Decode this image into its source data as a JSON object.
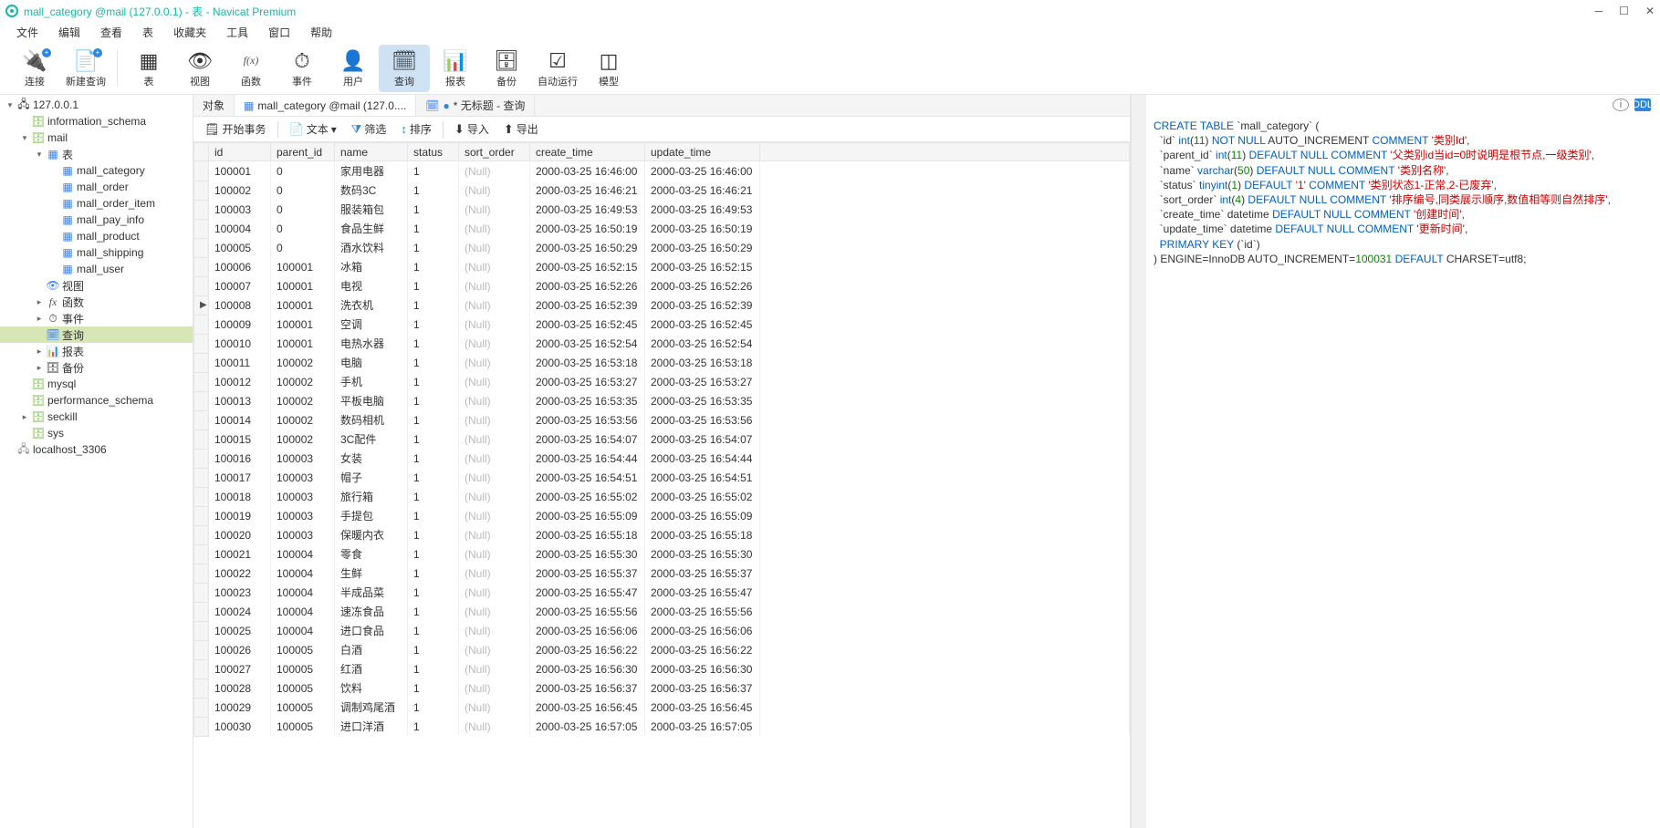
{
  "window": {
    "title": "mall_category @mail (127.0.0.1) - 表 - Navicat Premium"
  },
  "menu": [
    "文件",
    "编辑",
    "查看",
    "表",
    "收藏夹",
    "工具",
    "窗口",
    "帮助"
  ],
  "toolbar": [
    {
      "id": "connect",
      "label": "连接",
      "icon": "🔌",
      "plus": true
    },
    {
      "id": "newquery",
      "label": "新建查询",
      "icon": "📄",
      "plus": true
    },
    {
      "sep": true
    },
    {
      "id": "table",
      "label": "表",
      "icon": "▦"
    },
    {
      "id": "view",
      "label": "视图",
      "icon": "👁"
    },
    {
      "id": "function",
      "label": "函数",
      "icon": "f(x)"
    },
    {
      "id": "event",
      "label": "事件",
      "icon": "⏱"
    },
    {
      "id": "user",
      "label": "用户",
      "icon": "👤"
    },
    {
      "id": "query",
      "label": "查询",
      "icon": "🗓",
      "active": true
    },
    {
      "id": "report",
      "label": "报表",
      "icon": "📊"
    },
    {
      "id": "backup",
      "label": "备份",
      "icon": "🗄"
    },
    {
      "id": "auto",
      "label": "自动运行",
      "icon": "☑"
    },
    {
      "id": "model",
      "label": "模型",
      "icon": "◫"
    }
  ],
  "tree": [
    {
      "d": 0,
      "tw": "▾",
      "icon": "🖧",
      "cls": "icon-conn",
      "label": "127.0.0.1"
    },
    {
      "d": 1,
      "tw": "",
      "icon": "🗄",
      "label": "information_schema",
      "color": "#76c043"
    },
    {
      "d": 1,
      "tw": "▾",
      "icon": "🗄",
      "label": "mail",
      "color": "#76c043"
    },
    {
      "d": 2,
      "tw": "▾",
      "icon": "▦",
      "label": "表",
      "color": "#3b82f6"
    },
    {
      "d": 3,
      "tw": "",
      "icon": "▦",
      "label": "mall_category",
      "color": "#3b82f6"
    },
    {
      "d": 3,
      "tw": "",
      "icon": "▦",
      "label": "mall_order",
      "color": "#3b82f6"
    },
    {
      "d": 3,
      "tw": "",
      "icon": "▦",
      "label": "mall_order_item",
      "color": "#3b82f6"
    },
    {
      "d": 3,
      "tw": "",
      "icon": "▦",
      "label": "mall_pay_info",
      "color": "#3b82f6"
    },
    {
      "d": 3,
      "tw": "",
      "icon": "▦",
      "label": "mall_product",
      "color": "#3b82f6"
    },
    {
      "d": 3,
      "tw": "",
      "icon": "▦",
      "label": "mall_shipping",
      "color": "#3b82f6"
    },
    {
      "d": 3,
      "tw": "",
      "icon": "▦",
      "label": "mall_user",
      "color": "#3b82f6"
    },
    {
      "d": 2,
      "tw": "",
      "icon": "👁",
      "label": "视图",
      "color": "#3b82f6"
    },
    {
      "d": 2,
      "tw": "▸",
      "icon": "fx",
      "label": "函数"
    },
    {
      "d": 2,
      "tw": "▸",
      "icon": "⏱",
      "label": "事件"
    },
    {
      "d": 2,
      "tw": "",
      "icon": "🗓",
      "label": "查询",
      "sel": true,
      "color": "#3b82f6"
    },
    {
      "d": 2,
      "tw": "▸",
      "icon": "📊",
      "label": "报表"
    },
    {
      "d": 2,
      "tw": "▸",
      "icon": "🗄",
      "label": "备份"
    },
    {
      "d": 1,
      "tw": "",
      "icon": "🗄",
      "label": "mysql",
      "color": "#76c043"
    },
    {
      "d": 1,
      "tw": "",
      "icon": "🗄",
      "label": "performance_schema",
      "color": "#76c043"
    },
    {
      "d": 1,
      "tw": "▸",
      "icon": "🗄",
      "label": "seckill",
      "color": "#76c043"
    },
    {
      "d": 1,
      "tw": "",
      "icon": "🗄",
      "label": "sys",
      "color": "#76c043"
    },
    {
      "d": 0,
      "tw": "",
      "icon": "🖧",
      "label": "localhost_3306",
      "color": "#888"
    }
  ],
  "tabs": [
    {
      "label": "对象",
      "active": false
    },
    {
      "label": "mall_category @mail (127.0....",
      "active": true,
      "icon": "▦"
    },
    {
      "label": "* 无标题 - 查询",
      "active": false,
      "icon": "🗓",
      "dot": true
    }
  ],
  "subtoolbar": {
    "begin": "开始事务",
    "text": "文本",
    "filter": "筛选",
    "sort": "排序",
    "import": "导入",
    "export": "导出"
  },
  "columns": [
    "id",
    "parent_id",
    "name",
    "status",
    "sort_order",
    "create_time",
    "update_time"
  ],
  "rows": [
    [
      "100001",
      "0",
      "家用电器",
      "1",
      null,
      "2000-03-25 16:46:00",
      "2000-03-25 16:46:00"
    ],
    [
      "100002",
      "0",
      "数码3C",
      "1",
      null,
      "2000-03-25 16:46:21",
      "2000-03-25 16:46:21"
    ],
    [
      "100003",
      "0",
      "服装箱包",
      "1",
      null,
      "2000-03-25 16:49:53",
      "2000-03-25 16:49:53"
    ],
    [
      "100004",
      "0",
      "食品生鲜",
      "1",
      null,
      "2000-03-25 16:50:19",
      "2000-03-25 16:50:19"
    ],
    [
      "100005",
      "0",
      "酒水饮料",
      "1",
      null,
      "2000-03-25 16:50:29",
      "2000-03-25 16:50:29"
    ],
    [
      "100006",
      "100001",
      "冰箱",
      "1",
      null,
      "2000-03-25 16:52:15",
      "2000-03-25 16:52:15"
    ],
    [
      "100007",
      "100001",
      "电视",
      "1",
      null,
      "2000-03-25 16:52:26",
      "2000-03-25 16:52:26"
    ],
    [
      "100008",
      "100001",
      "洗衣机",
      "1",
      null,
      "2000-03-25 16:52:39",
      "2000-03-25 16:52:39",
      "▶"
    ],
    [
      "100009",
      "100001",
      "空调",
      "1",
      null,
      "2000-03-25 16:52:45",
      "2000-03-25 16:52:45"
    ],
    [
      "100010",
      "100001",
      "电热水器",
      "1",
      null,
      "2000-03-25 16:52:54",
      "2000-03-25 16:52:54"
    ],
    [
      "100011",
      "100002",
      "电脑",
      "1",
      null,
      "2000-03-25 16:53:18",
      "2000-03-25 16:53:18"
    ],
    [
      "100012",
      "100002",
      "手机",
      "1",
      null,
      "2000-03-25 16:53:27",
      "2000-03-25 16:53:27"
    ],
    [
      "100013",
      "100002",
      "平板电脑",
      "1",
      null,
      "2000-03-25 16:53:35",
      "2000-03-25 16:53:35"
    ],
    [
      "100014",
      "100002",
      "数码相机",
      "1",
      null,
      "2000-03-25 16:53:56",
      "2000-03-25 16:53:56"
    ],
    [
      "100015",
      "100002",
      "3C配件",
      "1",
      null,
      "2000-03-25 16:54:07",
      "2000-03-25 16:54:07"
    ],
    [
      "100016",
      "100003",
      "女装",
      "1",
      null,
      "2000-03-25 16:54:44",
      "2000-03-25 16:54:44"
    ],
    [
      "100017",
      "100003",
      "帽子",
      "1",
      null,
      "2000-03-25 16:54:51",
      "2000-03-25 16:54:51"
    ],
    [
      "100018",
      "100003",
      "旅行箱",
      "1",
      null,
      "2000-03-25 16:55:02",
      "2000-03-25 16:55:02"
    ],
    [
      "100019",
      "100003",
      "手提包",
      "1",
      null,
      "2000-03-25 16:55:09",
      "2000-03-25 16:55:09"
    ],
    [
      "100020",
      "100003",
      "保暖内衣",
      "1",
      null,
      "2000-03-25 16:55:18",
      "2000-03-25 16:55:18"
    ],
    [
      "100021",
      "100004",
      "零食",
      "1",
      null,
      "2000-03-25 16:55:30",
      "2000-03-25 16:55:30"
    ],
    [
      "100022",
      "100004",
      "生鲜",
      "1",
      null,
      "2000-03-25 16:55:37",
      "2000-03-25 16:55:37"
    ],
    [
      "100023",
      "100004",
      "半成品菜",
      "1",
      null,
      "2000-03-25 16:55:47",
      "2000-03-25 16:55:47"
    ],
    [
      "100024",
      "100004",
      "速冻食品",
      "1",
      null,
      "2000-03-25 16:55:56",
      "2000-03-25 16:55:56"
    ],
    [
      "100025",
      "100004",
      "进口食品",
      "1",
      null,
      "2000-03-25 16:56:06",
      "2000-03-25 16:56:06"
    ],
    [
      "100026",
      "100005",
      "白酒",
      "1",
      null,
      "2000-03-25 16:56:22",
      "2000-03-25 16:56:22"
    ],
    [
      "100027",
      "100005",
      "红酒",
      "1",
      null,
      "2000-03-25 16:56:30",
      "2000-03-25 16:56:30"
    ],
    [
      "100028",
      "100005",
      "饮料",
      "1",
      null,
      "2000-03-25 16:56:37",
      "2000-03-25 16:56:37"
    ],
    [
      "100029",
      "100005",
      "调制鸡尾酒",
      "1",
      null,
      "2000-03-25 16:56:45",
      "2000-03-25 16:56:45"
    ],
    [
      "100030",
      "100005",
      "进口洋酒",
      "1",
      null,
      "2000-03-25 16:57:05",
      "2000-03-25 16:57:05"
    ]
  ],
  "ddl": {
    "tablename": "mall_category",
    "lines": [
      [
        [
          "kw",
          "CREATE TABLE"
        ],
        [
          "",
          " `mall_category` ("
        ]
      ],
      [
        [
          "",
          "  `id` "
        ],
        [
          "ty",
          "int"
        ],
        [
          "",
          "("
        ],
        [
          "num",
          "11"
        ],
        [
          "",
          ") "
        ],
        [
          "kw",
          "NOT NULL"
        ],
        [
          "",
          " AUTO_INCREMENT "
        ],
        [
          "kw",
          "COMMENT"
        ],
        [
          "",
          " "
        ],
        [
          "str",
          "'类别Id'"
        ],
        [
          "",
          ","
        ]
      ],
      [
        [
          "",
          "  `parent_id` "
        ],
        [
          "ty",
          "int"
        ],
        [
          "",
          "("
        ],
        [
          "num",
          "11"
        ],
        [
          "",
          ") "
        ],
        [
          "kw",
          "DEFAULT NULL COMMENT"
        ],
        [
          "",
          " "
        ],
        [
          "str",
          "'父类别id当id=0时说明是根节点,一级类别'"
        ],
        [
          "",
          ","
        ]
      ],
      [
        [
          "",
          "  `name` "
        ],
        [
          "ty",
          "varchar"
        ],
        [
          "",
          "("
        ],
        [
          "num",
          "50"
        ],
        [
          "",
          ") "
        ],
        [
          "kw",
          "DEFAULT NULL COMMENT"
        ],
        [
          "",
          " "
        ],
        [
          "str",
          "'类别名称'"
        ],
        [
          "",
          ","
        ]
      ],
      [
        [
          "",
          "  `status` "
        ],
        [
          "ty",
          "tinyint"
        ],
        [
          "",
          "("
        ],
        [
          "num",
          "1"
        ],
        [
          "",
          ") "
        ],
        [
          "kw",
          "DEFAULT"
        ],
        [
          "",
          " "
        ],
        [
          "str",
          "'1'"
        ],
        [
          "",
          " "
        ],
        [
          "kw",
          "COMMENT"
        ],
        [
          "",
          " "
        ],
        [
          "str",
          "'类别状态1-正常,2-已废弃'"
        ],
        [
          "",
          ","
        ]
      ],
      [
        [
          "",
          "  `sort_order` "
        ],
        [
          "ty",
          "int"
        ],
        [
          "",
          "("
        ],
        [
          "num",
          "4"
        ],
        [
          "",
          ") "
        ],
        [
          "kw",
          "DEFAULT NULL COMMENT"
        ],
        [
          "",
          " "
        ],
        [
          "str",
          "'排序编号,同类展示顺序,数值相等则自然排序'"
        ],
        [
          "",
          ","
        ]
      ],
      [
        [
          "",
          "  `create_time` datetime "
        ],
        [
          "kw",
          "DEFAULT NULL COMMENT"
        ],
        [
          "",
          " "
        ],
        [
          "str",
          "'创建时间'"
        ],
        [
          "",
          ","
        ]
      ],
      [
        [
          "",
          "  `update_time` datetime "
        ],
        [
          "kw",
          "DEFAULT NULL COMMENT"
        ],
        [
          "",
          " "
        ],
        [
          "str",
          "'更新时间'"
        ],
        [
          "",
          ","
        ]
      ],
      [
        [
          "",
          "  "
        ],
        [
          "kw",
          "PRIMARY KEY"
        ],
        [
          "",
          " (`id`)"
        ]
      ],
      [
        [
          "",
          ") ENGINE=InnoDB AUTO_INCREMENT="
        ],
        [
          "num",
          "100031"
        ],
        [
          "",
          " "
        ],
        [
          "kw",
          "DEFAULT"
        ],
        [
          "",
          " CHARSET=utf8;"
        ]
      ]
    ]
  },
  "nullLabel": "(Null)"
}
